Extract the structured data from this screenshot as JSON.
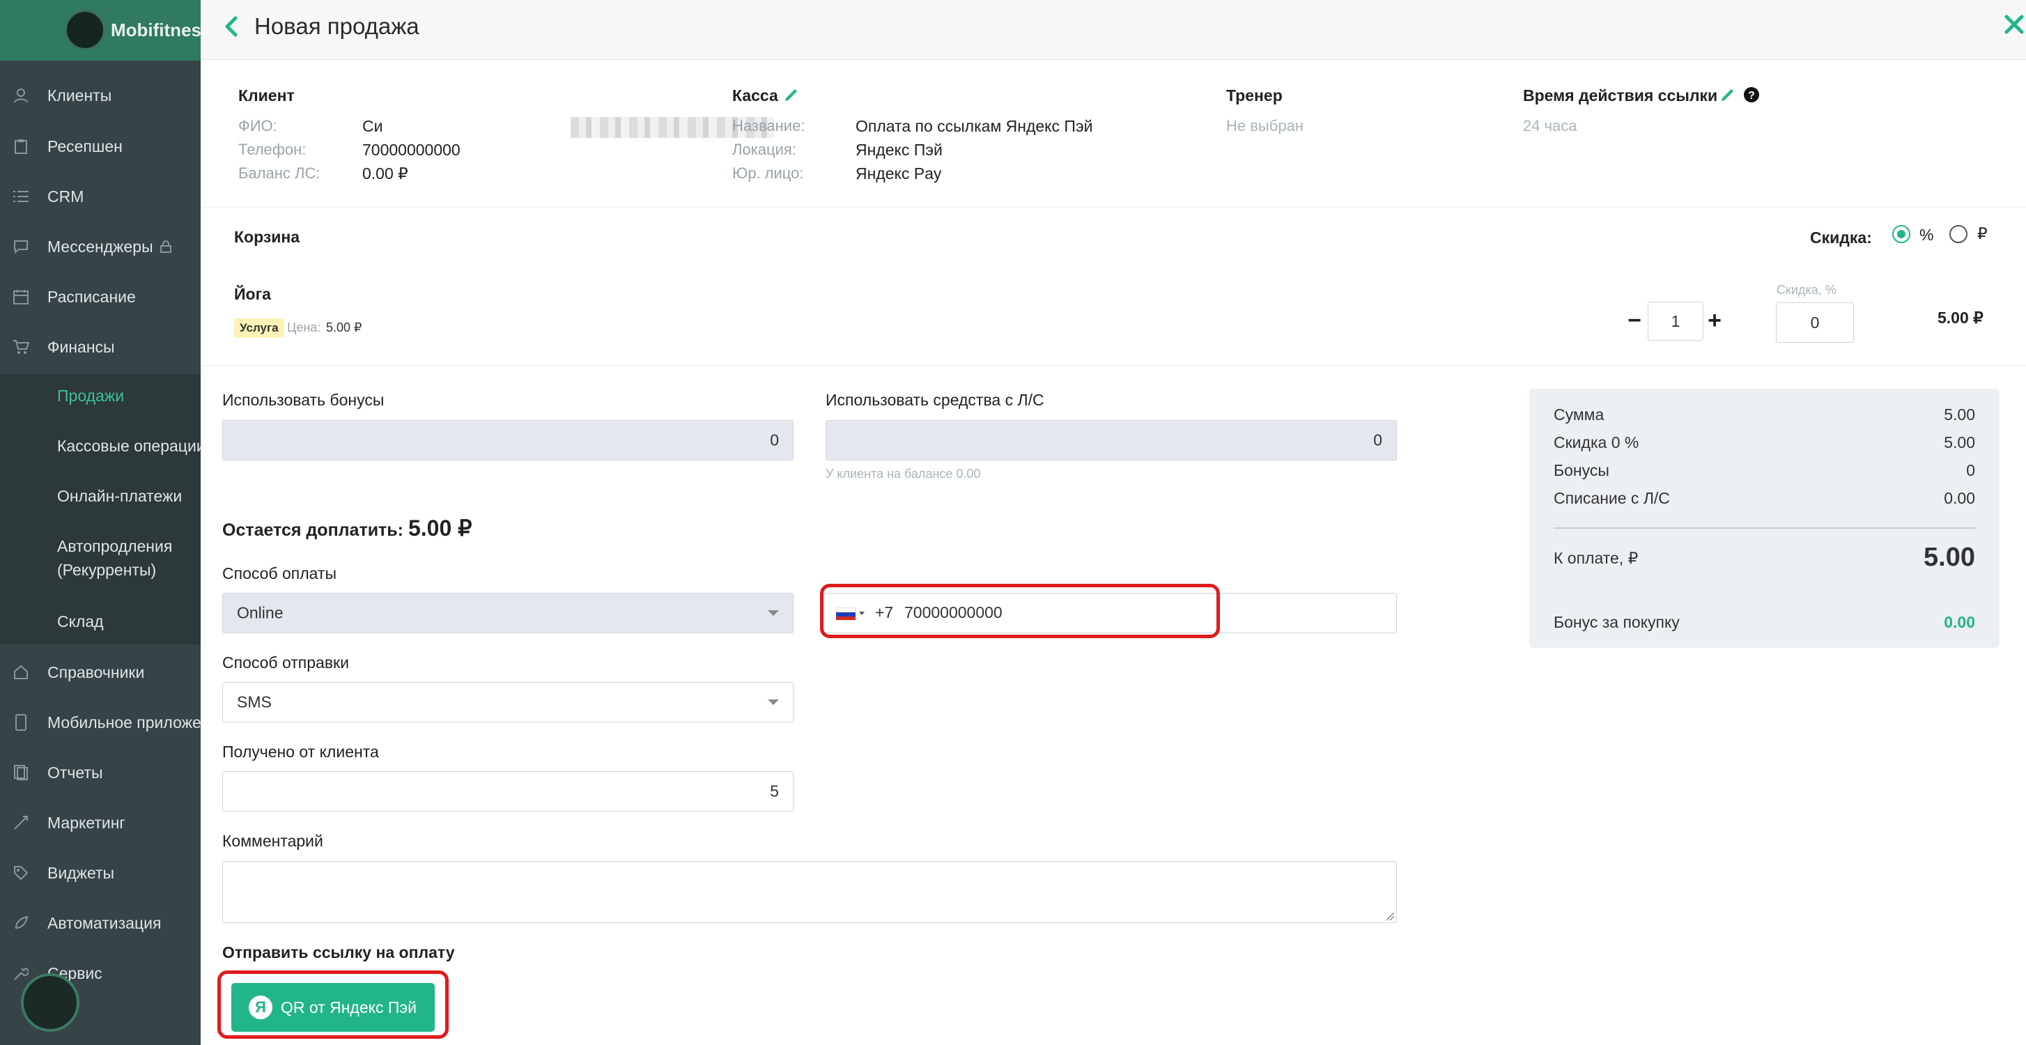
{
  "app": {
    "brand": "Mobifitness"
  },
  "sidebar": {
    "items": [
      {
        "label": "Клиенты",
        "icon": "clients-icon"
      },
      {
        "label": "Ресепшен",
        "icon": "clipboard-icon"
      },
      {
        "label": "CRM",
        "icon": "list-icon"
      },
      {
        "label": "Мессенджеры",
        "icon": "chat-icon"
      },
      {
        "label": "Расписание",
        "icon": "calendar-icon"
      },
      {
        "label": "Финансы",
        "icon": "cart-icon"
      },
      {
        "label": "Справочники",
        "icon": "home-icon"
      },
      {
        "label": "Мобильное приложение",
        "icon": "mobile-icon"
      },
      {
        "label": "Отчеты",
        "icon": "report-icon"
      },
      {
        "label": "Маркетинг",
        "icon": "megaphone-icon"
      },
      {
        "label": "Виджеты",
        "icon": "tag-icon"
      },
      {
        "label": "Автоматизация",
        "icon": "rocket-icon"
      },
      {
        "label": "Сервис",
        "icon": "wrench-icon"
      }
    ],
    "finance_sub": [
      {
        "label": "Продажи",
        "active": true
      },
      {
        "label": "Кассовые операции"
      },
      {
        "label": "Онлайн-платежи"
      },
      {
        "label": "Автопродления"
      },
      {
        "label": "(Рекурренты)"
      },
      {
        "label": "Склад"
      }
    ]
  },
  "modal": {
    "title": "Новая продажа",
    "client": {
      "header": "Клиент",
      "fio_label": "ФИО:",
      "fio_value": "Си",
      "phone_label": "Телефон:",
      "phone_value": "70000000000",
      "balance_label": "Баланс ЛС:",
      "balance_value": "0.00 ₽"
    },
    "kassa": {
      "header": "Касса",
      "name_label": "Название:",
      "name_value": "Оплата по ссылкам Яндекс Пэй",
      "location_label": "Локация:",
      "location_value": "Яндекс Пэй",
      "legal_label": "Юр. лицо:",
      "legal_value": "Яндекс Pay"
    },
    "trainer": {
      "header": "Тренер",
      "value": "Не выбран"
    },
    "link_time": {
      "header": "Время действия ссылки",
      "value": "24 часа"
    },
    "cart": {
      "header": "Корзина",
      "discount_label": "Скидка:",
      "discount_opt_percent": "%",
      "discount_opt_rub": "₽",
      "item": {
        "name": "Йога",
        "badge": "Услуга",
        "price_label": "Цена:",
        "price_value": "5.00 ₽",
        "qty": "1",
        "discount_field_label": "Скидка, %",
        "discount_value": "0",
        "total": "5.00 ₽"
      }
    },
    "form": {
      "bonus_label": "Использовать бонусы",
      "bonus_value": "0",
      "ls_label": "Использовать средства с Л/С",
      "ls_value": "0",
      "ls_hint": "У клиента на балансе 0.00",
      "remaining_label": "Остается доплатить:",
      "remaining_value": "5.00 ₽",
      "payment_method_label": "Способ оплаты",
      "payment_method_value": "Online",
      "phone_code": "+7",
      "phone_number": "70000000000",
      "send_method_label": "Способ отправки",
      "send_method_value": "SMS",
      "received_label": "Получено от клиента",
      "received_value": "5",
      "comment_label": "Комментарий",
      "comment_value": "",
      "send_link_header": "Отправить ссылку на оплату",
      "qr_button": "QR от Яндекс Пэй",
      "qr_logo_letter": "Я"
    },
    "summary": {
      "sum_label": "Сумма",
      "sum_value": "5.00",
      "discount_label": "Скидка 0 %",
      "discount_value": "5.00",
      "bonuses_label": "Бонусы",
      "bonuses_value": "0",
      "ls_label": "Списание с Л/С",
      "ls_value": "0.00",
      "to_pay_label": "К оплате, ₽",
      "to_pay_value": "5.00",
      "bonus_purchase_label": "Бонус за покупку",
      "bonus_purchase_value": "0.00"
    }
  },
  "colors": {
    "accent": "#23b58a",
    "highlight": "#e01b1b",
    "sidebar_bg": "#364347"
  }
}
